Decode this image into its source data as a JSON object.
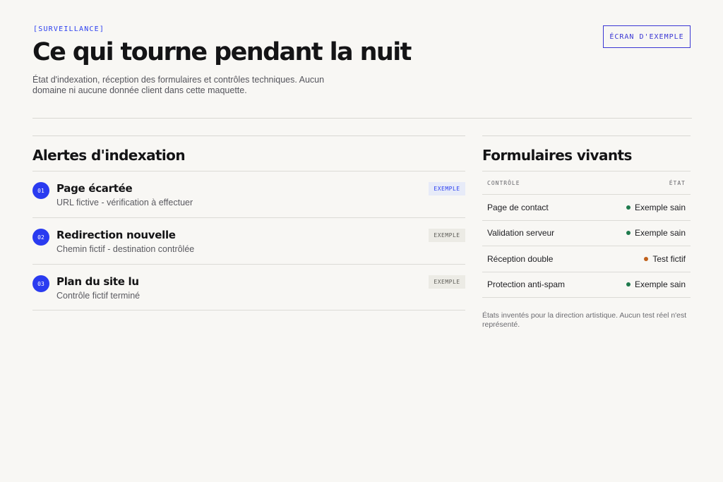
{
  "header": {
    "eyebrow": "[SURVEILLANCE]",
    "title": "Ce qui tourne pendant la nuit",
    "subtitle": "État d'indexation, réception des formulaires et contrôles techniques. Aucun domaine ni aucune donnée client dans cette maquette.",
    "button_label": "ÉCRAN D'EXEMPLE"
  },
  "alerts": {
    "title": "Alertes d'indexation",
    "items": [
      {
        "num": "01",
        "title": "Page écartée",
        "desc": "URL fictive - vérification à effectuer",
        "badge": "EXEMPLE",
        "badge_style": "blue"
      },
      {
        "num": "02",
        "title": "Redirection nouvelle",
        "desc": "Chemin fictif - destination contrôlée",
        "badge": "EXEMPLE",
        "badge_style": "beige"
      },
      {
        "num": "03",
        "title": "Plan du site lu",
        "desc": "Contrôle fictif terminé",
        "badge": "EXEMPLE",
        "badge_style": "beige"
      }
    ]
  },
  "forms": {
    "title": "Formulaires vivants",
    "col_control": "CONTRÔLE",
    "col_state": "ÉTAT",
    "rows": [
      {
        "label": "Page de contact",
        "status": "Exemple sain",
        "dot_color": "#1f7a4d"
      },
      {
        "label": "Validation serveur",
        "status": "Exemple sain",
        "dot_color": "#1f7a4d"
      },
      {
        "label": "Réception double",
        "status": "Test fictif",
        "dot_color": "#c0601a"
      },
      {
        "label": "Protection anti-spam",
        "status": "Exemple sain",
        "dot_color": "#1f7a4d"
      }
    ],
    "footnote": "États inventés pour la direction artistique. Aucun test réel n'est représenté."
  },
  "colors": {
    "accent": "#2a3bf0",
    "button": "#3a36d4",
    "background": "#f8f7f4"
  }
}
